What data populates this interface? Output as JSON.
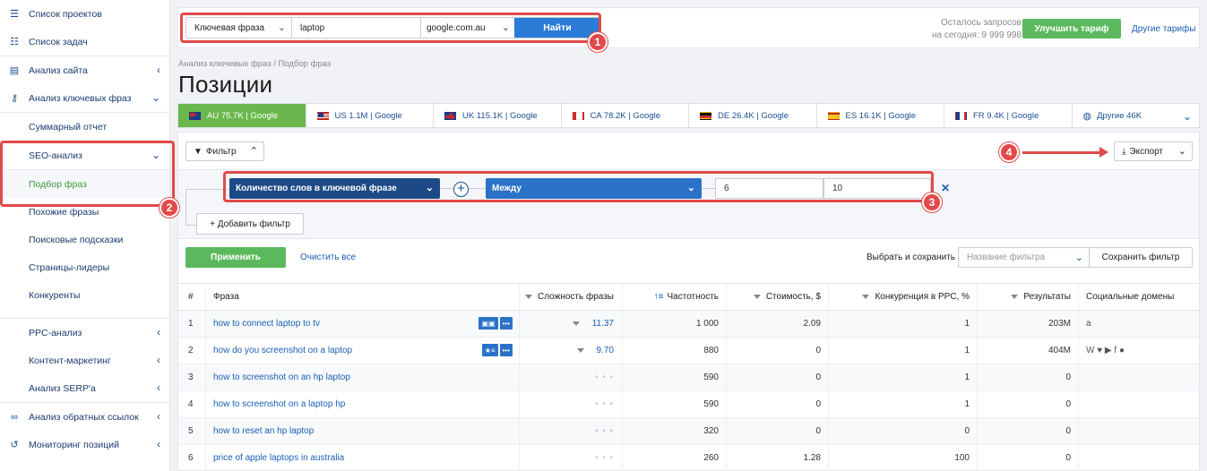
{
  "sidebar": {
    "items": [
      {
        "label": "Список проектов",
        "icon": "menu-icon"
      },
      {
        "label": "Список задач",
        "icon": "list-icon"
      },
      {
        "label": "Анализ сайта",
        "icon": "site-analysis-icon"
      },
      {
        "label": "Анализ ключевых фраз",
        "icon": "key-icon"
      }
    ],
    "sub_items": [
      {
        "label": "Суммарный отчет"
      },
      {
        "label": "SEO-анализ"
      },
      {
        "label": "Подбор фраз"
      },
      {
        "label": "Похожие фразы"
      },
      {
        "label": "Поисковые подсказки"
      },
      {
        "label": "Страницы-лидеры"
      },
      {
        "label": "Конкуренты"
      },
      {
        "label": "PPC-анализ"
      },
      {
        "label": "Контент-маркетинг"
      },
      {
        "label": "Анализ SERP'а"
      }
    ],
    "bottom_items": [
      {
        "label": "Анализ обратных ссылок",
        "icon": "link-icon"
      },
      {
        "label": "Мониторинг позиций",
        "icon": "history-icon"
      }
    ]
  },
  "search": {
    "type_label": "Ключевая фраза",
    "query": "laptop",
    "domain": "google.com.au",
    "find_label": "Найти"
  },
  "quota": {
    "line1": "Осталось запросов",
    "line2": "на сегодня: 9 999 998"
  },
  "upgrade_label": "Улучшить тариф",
  "other_plans_label": "Другие тарифы",
  "breadcrumb": "Анализ ключевых фраз / Подбор фраз",
  "page_title": "Позиции",
  "tabs": [
    {
      "label": "AU 75.7K | Google",
      "flag": "au"
    },
    {
      "label": "US 1.1M | Google",
      "flag": "us"
    },
    {
      "label": "UK 115.1K | Google",
      "flag": "uk"
    },
    {
      "label": "CA 78.2K | Google",
      "flag": "ca"
    },
    {
      "label": "DE 26.4K | Google",
      "flag": "de"
    },
    {
      "label": "ES 16.1K | Google",
      "flag": "es"
    },
    {
      "label": "FR 9.4K | Google",
      "flag": "fr"
    },
    {
      "label": "Другие 46K",
      "flag": "globe"
    }
  ],
  "filter": {
    "toggle_label": "Фильтр",
    "export_label": "Экспорт",
    "field": "Количество слов в ключевой фразе",
    "operator": "Между",
    "value_from": "6",
    "value_to": "10",
    "add_label": "+ Добавить фильтр",
    "apply_label": "Применить",
    "clear_label": "Очистить все",
    "choose_save_label": "Выбрать и сохранить",
    "name_placeholder": "Название фильтра",
    "save_label": "Сохранить фильтр"
  },
  "table": {
    "headers": {
      "num": "#",
      "phrase": "Фраза",
      "difficulty": "Сложность фразы",
      "frequency": "Частотность",
      "cost": "Стоимость, $",
      "competition": "Конкуренция в PPC, %",
      "results": "Результаты",
      "social": "Социальные домены"
    },
    "rows": [
      {
        "num": "1",
        "phrase": "how to connect laptop to tv",
        "difficulty": "11.37",
        "frequency": "1 000",
        "cost": "2.09",
        "competition": "1",
        "results": "203M",
        "social": "a"
      },
      {
        "num": "2",
        "phrase": "how do you screenshot on a laptop",
        "difficulty": "9.70",
        "frequency": "880",
        "cost": "0",
        "competition": "1",
        "results": "404M",
        "social": "W ♥ ▶ f ●"
      },
      {
        "num": "3",
        "phrase": "how to screenshot on an hp laptop",
        "difficulty": "",
        "frequency": "590",
        "cost": "0",
        "competition": "1",
        "results": "0",
        "social": ""
      },
      {
        "num": "4",
        "phrase": "how to screenshot on a laptop hp",
        "difficulty": "",
        "frequency": "590",
        "cost": "0",
        "competition": "1",
        "results": "0",
        "social": ""
      },
      {
        "num": "5",
        "phrase": "how to reset an hp laptop",
        "difficulty": "",
        "frequency": "320",
        "cost": "0",
        "competition": "0",
        "results": "0",
        "social": ""
      },
      {
        "num": "6",
        "phrase": "price of apple laptops in australia",
        "difficulty": "",
        "frequency": "260",
        "cost": "1.28",
        "competition": "100",
        "results": "0",
        "social": ""
      }
    ]
  },
  "annotations": [
    "1",
    "2",
    "3",
    "4"
  ],
  "colors": {
    "primary": "#2a7cd6",
    "green": "#5cb85c",
    "active_tab": "#6ab84d",
    "highlight": "#e24a4a",
    "navy": "#1d4a86"
  }
}
